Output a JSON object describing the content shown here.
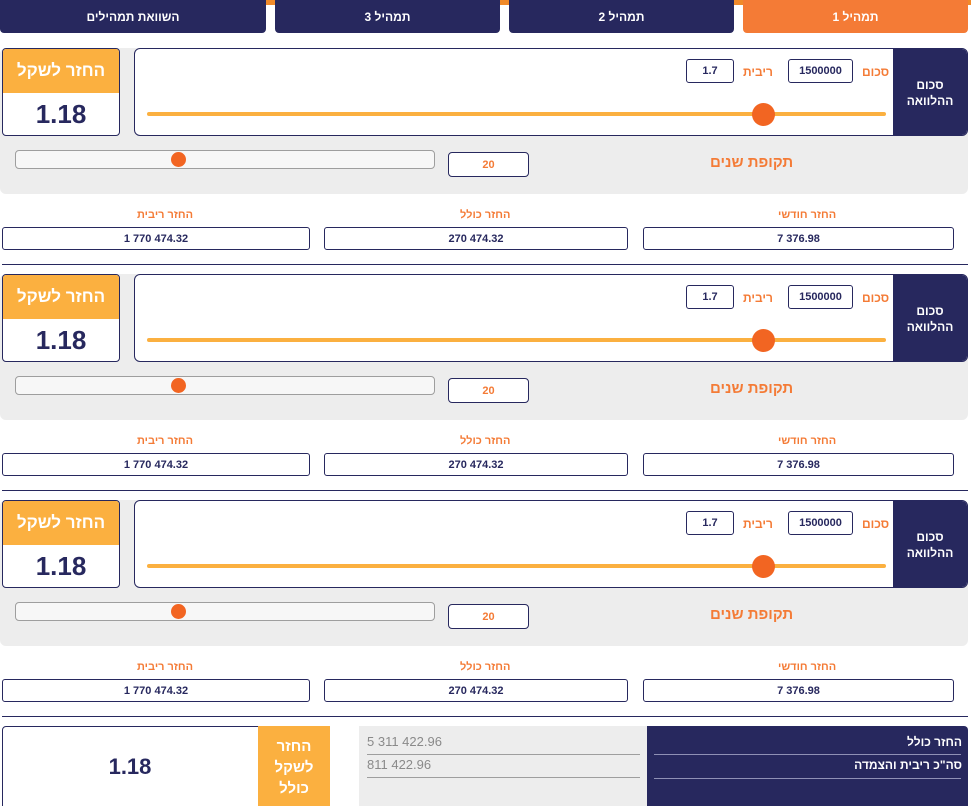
{
  "tabs": [
    {
      "label": "תמהיל 1",
      "active": true
    },
    {
      "label": "תמהיל 2",
      "active": false
    },
    {
      "label": "תמהיל 3",
      "active": false
    },
    {
      "label": "השוואת תמהילים",
      "active": false
    }
  ],
  "mixes": [
    {
      "return_per_shekel_label": "החזר לשקל",
      "return_per_shekel_value": "1.18",
      "loan_amount_label": "סכום ההלוואה",
      "amount_label": "סכום",
      "amount_value": "1500000",
      "rate_label": "ריבית",
      "rate_value": "1.7",
      "years_label": "תקופת שנים",
      "years_value": "20",
      "monthly_label": "החזר חודשי",
      "monthly_value": "7 376.98",
      "total_label": "החזר כולל",
      "total_value": "270 474.32",
      "interest_label": "החזר ריבית",
      "interest_value": "1 770 474.32"
    },
    {
      "return_per_shekel_label": "החזר לשקל",
      "return_per_shekel_value": "1.18",
      "loan_amount_label": "סכום ההלוואה",
      "amount_label": "סכום",
      "amount_value": "1500000",
      "rate_label": "ריבית",
      "rate_value": "1.7",
      "years_label": "תקופת שנים",
      "years_value": "20",
      "monthly_label": "החזר חודשי",
      "monthly_value": "7 376.98",
      "total_label": "החזר כולל",
      "total_value": "270 474.32",
      "interest_label": "החזר ריבית",
      "interest_value": "1 770 474.32"
    },
    {
      "return_per_shekel_label": "החזר לשקל",
      "return_per_shekel_value": "1.18",
      "loan_amount_label": "סכום ההלוואה",
      "amount_label": "סכום",
      "amount_value": "1500000",
      "rate_label": "ריבית",
      "rate_value": "1.7",
      "years_label": "תקופת שנים",
      "years_value": "20",
      "monthly_label": "החזר חודשי",
      "monthly_value": "7 376.98",
      "total_label": "החזר כולל",
      "total_value": "270 474.32",
      "interest_label": "החזר ריבית",
      "interest_value": "1 770 474.32"
    }
  ],
  "summary": {
    "total_return_label": "החזר כולל",
    "total_interest_label": "סה\"כ ריבית והצמדה",
    "total_return_value": "5 311 422.96",
    "total_interest_value": "811 422.96",
    "return_per_shekel_label": "החזר לשקל כולל",
    "return_per_shekel_value": "1.18"
  },
  "colors": {
    "navy": "#27285e",
    "orange": "#f47b36",
    "amber": "#fbb040",
    "panel_gray": "#ededed"
  }
}
